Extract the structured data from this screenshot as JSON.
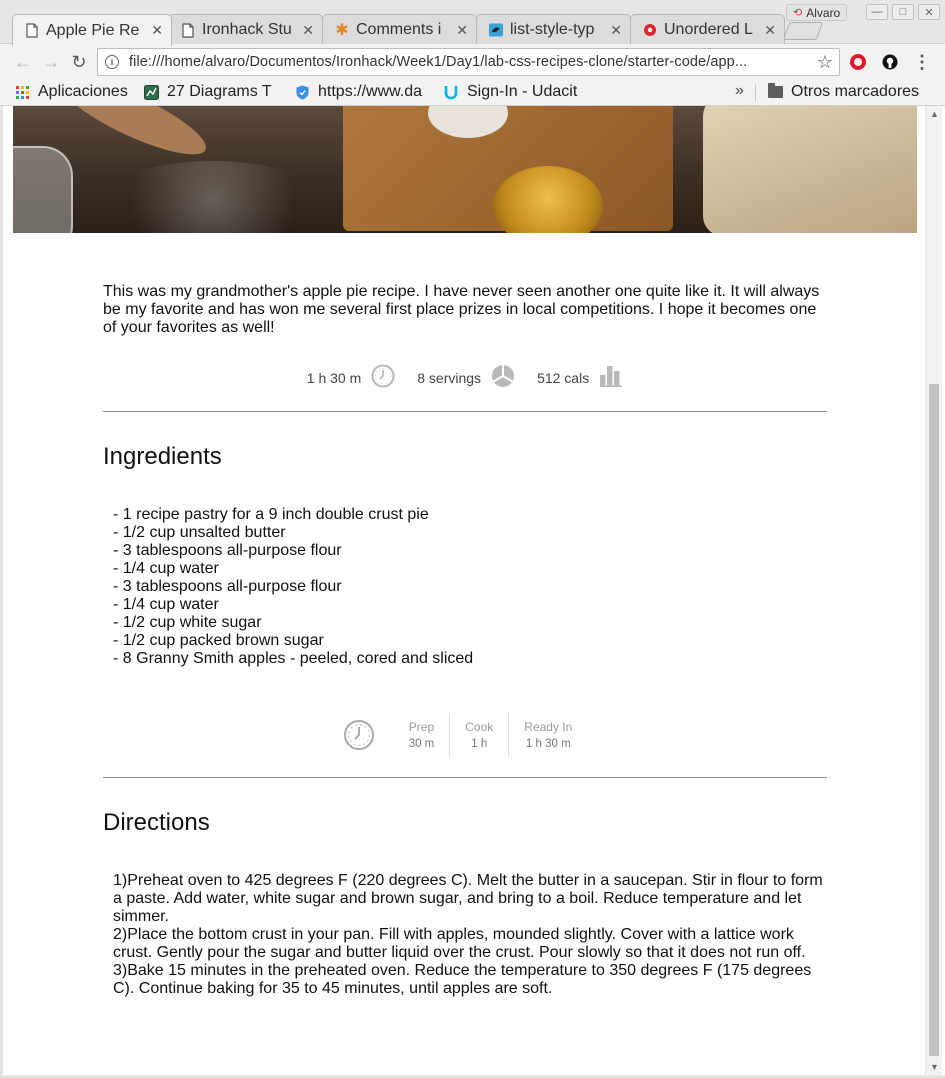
{
  "window": {
    "profile_name": "Alvaro",
    "controls": {
      "minimize": "—",
      "maximize": "□",
      "close": "✕"
    }
  },
  "tabs": [
    {
      "title": "Apple Pie Re",
      "icon": "page-icon",
      "active": true
    },
    {
      "title": "Ironhack Stu",
      "icon": "page-icon",
      "active": false
    },
    {
      "title": "Comments i",
      "icon": "comments-icon",
      "active": false
    },
    {
      "title": "list-style-typ",
      "icon": "bird-icon",
      "active": false
    },
    {
      "title": "Unordered L",
      "icon": "site-icon",
      "active": false
    }
  ],
  "toolbar": {
    "back": "←",
    "forward": "→",
    "reload": "↻",
    "url": "file:///home/alvaro/Documentos/Ironhack/Week1/Day1/lab-css-recipes-clone/starter-code/app...",
    "info_glyph": "i",
    "star": "☆",
    "menu": "⋮"
  },
  "bookmarks": {
    "items": [
      {
        "label": "Aplicaciones",
        "icon": "apps-grid-icon"
      },
      {
        "label": "27 Diagrams T",
        "icon": "diagram-icon"
      },
      {
        "label": "https://www.da",
        "icon": "shield-icon"
      },
      {
        "label": "Sign-In - Udacit",
        "icon": "udacity-icon"
      }
    ],
    "more": "»",
    "other_folder": "Otros marcadores"
  },
  "recipe": {
    "intro": "This was my grandmother's apple pie recipe. I have never seen another one quite like it. It will always be my favorite and has won me several first place prizes in local competitions. I hope it becomes one of your favorites as well!",
    "stats": {
      "time": "1 h 30 m",
      "servings": "8 servings",
      "calories": "512 cals"
    },
    "ingredients": {
      "title": "Ingredients",
      "items": [
        "- 1 recipe pastry for a 9 inch double crust pie",
        "- 1/2 cup unsalted butter",
        "- 3 tablespoons all-purpose flour",
        "- 1/4 cup water",
        "- 3 tablespoons all-purpose flour",
        "- 1/4 cup water",
        "- 1/2 cup white sugar",
        "- 1/2 cup packed brown sugar",
        "- 8 Granny Smith apples - peeled, cored and sliced"
      ]
    },
    "times": [
      {
        "label": "Prep",
        "value": "30 m"
      },
      {
        "label": "Cook",
        "value": "1 h"
      },
      {
        "label": "Ready In",
        "value": "1 h 30 m"
      }
    ],
    "directions": {
      "title": "Directions",
      "items": [
        "1)Preheat oven to 425 degrees F (220 degrees C). Melt the butter in a saucepan. Stir in flour to form a paste. Add water, white sugar and brown sugar, and bring to a boil. Reduce temperature and let simmer.",
        "2)Place the bottom crust in your pan. Fill with apples, mounded slightly. Cover with a lattice work crust. Gently pour the sugar and butter liquid over the crust. Pour slowly so that it does not run off.",
        "3)Bake 15 minutes in the preheated oven. Reduce the temperature to 350 degrees F (175 degrees C). Continue baking for 35 to 45 minutes, until apples are soft."
      ]
    }
  },
  "colors": {
    "accent_opera": "#e0182d",
    "text": "#111111",
    "muted_icon": "#b8b8b8"
  }
}
